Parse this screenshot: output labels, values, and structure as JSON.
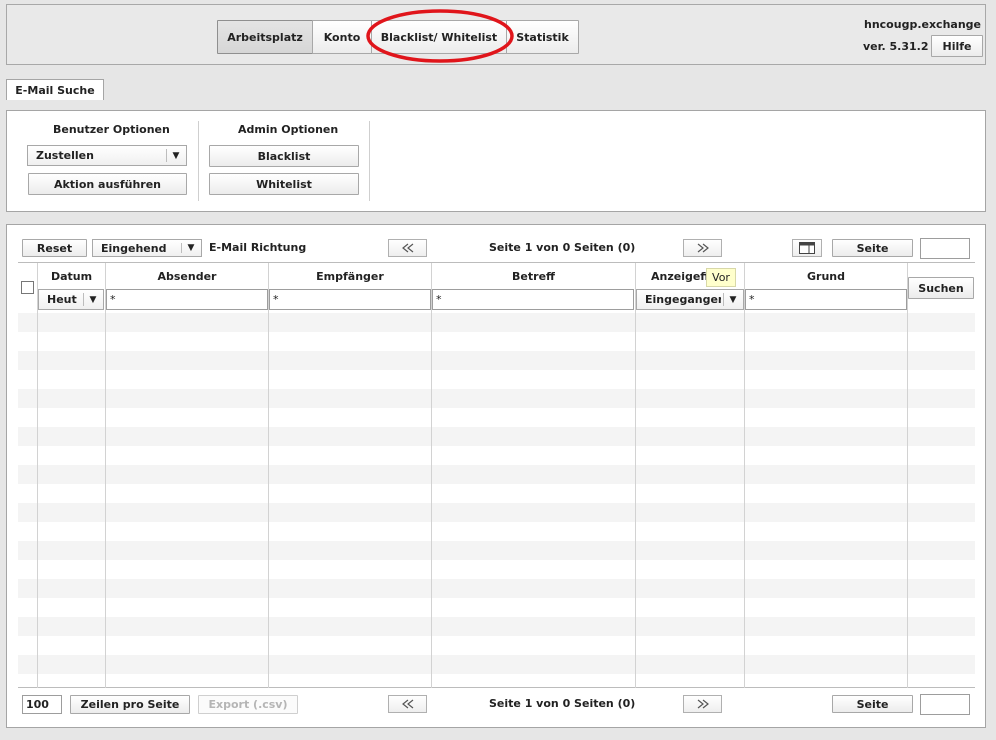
{
  "header": {
    "tabs": [
      {
        "label": "Arbeitsplatz",
        "active": true
      },
      {
        "label": "Konto"
      },
      {
        "label": "Blacklist/ Whitelist",
        "highlighted": true
      },
      {
        "label": "Statistik"
      }
    ],
    "server_name": "hncougp.exchange",
    "version": "ver. 5.31.2",
    "help_label": "Hilfe"
  },
  "section_tab": "E-Mail Suche",
  "options": {
    "user_title": "Benutzer Optionen",
    "user_select_value": "Zustellen",
    "execute_label": "Aktion ausführen",
    "admin_title": "Admin Optionen",
    "blacklist_label": "Blacklist",
    "whitelist_label": "Whitelist"
  },
  "toolbar_top": {
    "reset_label": "Reset",
    "direction_value": "Eingehend",
    "direction_label": "E-Mail Richtung",
    "page_info": "Seite 1 von 0 Seiten (0)",
    "page_button": "Seite",
    "page_input": ""
  },
  "table": {
    "columns": [
      "Datum",
      "Absender",
      "Empfänger",
      "Betreff",
      "Anzeigefi",
      "Grund"
    ],
    "filters": {
      "date_value": "Heut",
      "sender": "*",
      "recipient": "*",
      "subject": "*",
      "display_value": "Eingegangen",
      "reason": "*"
    },
    "search_label": "Suchen",
    "tooltip": "Vor"
  },
  "toolbar_bottom": {
    "rows_value": "100",
    "rows_label": "Zeilen pro Seite",
    "export_label": "Export (.csv)",
    "page_info": "Seite 1 von 0 Seiten (0)",
    "page_button": "Seite",
    "page_input": ""
  },
  "colors": {
    "highlight_ellipse": "#e0151b",
    "tooltip_bg": "#ffffcc"
  }
}
